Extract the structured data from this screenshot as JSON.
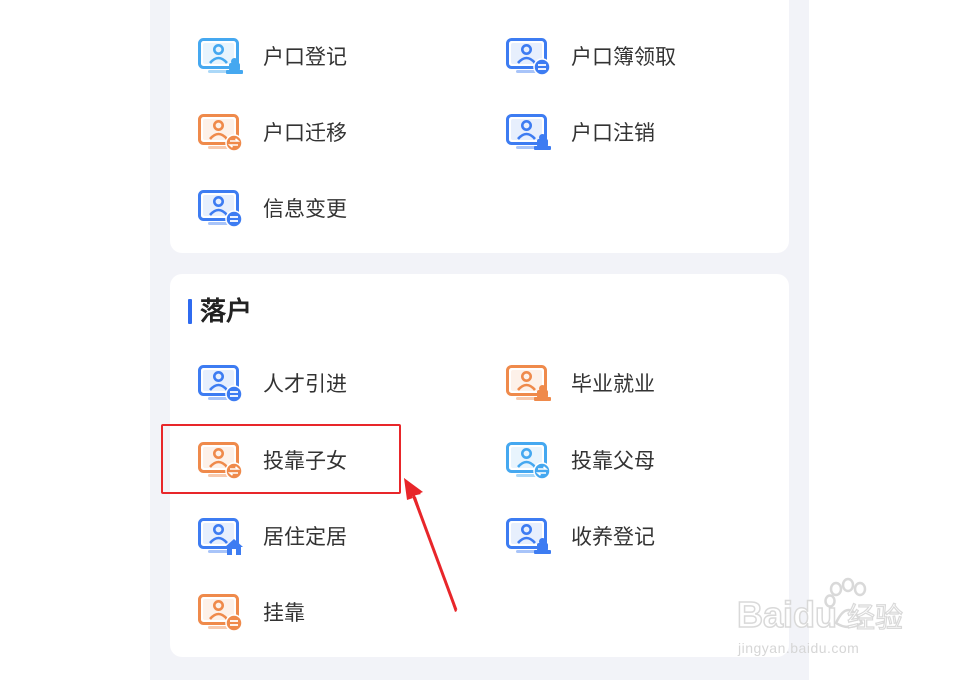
{
  "colors": {
    "blue_icon": "#3d7cf2",
    "orange_icon": "#ef8a4b",
    "teal_icon": "#45a8f0",
    "accent_bar": "#2f6bf0",
    "annotation_red": "#e8262a"
  },
  "top_section": {
    "items": [
      {
        "label": "户口登记",
        "icon": "household-register-icon",
        "color": "#45a8f0",
        "badge": "stamp"
      },
      {
        "label": "户口簿领取",
        "icon": "household-book-icon",
        "color": "#3d7cf2",
        "badge": "minus"
      },
      {
        "label": "户口迁移",
        "icon": "household-migrate-icon",
        "color": "#ef8a4b",
        "badge": "swap"
      },
      {
        "label": "户口注销",
        "icon": "household-cancel-icon",
        "color": "#3d7cf2",
        "badge": "stamp"
      },
      {
        "label": "信息变更",
        "icon": "info-change-icon",
        "color": "#3d7cf2",
        "badge": "minus"
      }
    ]
  },
  "settle_section": {
    "title": "落户",
    "items": [
      {
        "label": "人才引进",
        "icon": "talent-import-icon",
        "color": "#3d7cf2",
        "badge": "minus"
      },
      {
        "label": "毕业就业",
        "icon": "graduate-employment-icon",
        "color": "#ef8a4b",
        "badge": "stamp"
      },
      {
        "label": "投靠子女",
        "icon": "join-children-icon",
        "color": "#ef8a4b",
        "badge": "swap"
      },
      {
        "label": "投靠父母",
        "icon": "join-parents-icon",
        "color": "#45a8f0",
        "badge": "swap"
      },
      {
        "label": "居住定居",
        "icon": "residence-settle-icon",
        "color": "#3d7cf2",
        "badge": "house"
      },
      {
        "label": "收养登记",
        "icon": "adoption-register-icon",
        "color": "#3d7cf2",
        "badge": "stamp"
      },
      {
        "label": "挂靠",
        "icon": "affiliation-icon",
        "color": "#ef8a4b",
        "badge": "minus"
      }
    ]
  },
  "watermark": {
    "brand": "Baidu",
    "suffix": "经验",
    "url": "jingyan.baidu.com"
  }
}
